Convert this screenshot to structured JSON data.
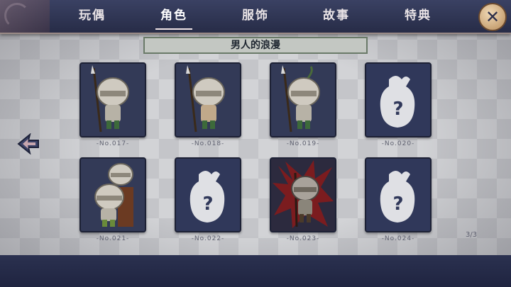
{
  "tabs": [
    {
      "label": "玩偶",
      "active": false
    },
    {
      "label": "角色",
      "active": true
    },
    {
      "label": "服饰",
      "active": false
    },
    {
      "label": "故事",
      "active": false
    },
    {
      "label": "特典",
      "active": false
    }
  ],
  "close_icon": "close-icon",
  "banner_title": "男人的浪漫",
  "cards": [
    {
      "id": "-No.017-",
      "state": "unlocked",
      "figure": "knight-with-spear"
    },
    {
      "id": "-No.018-",
      "state": "unlocked",
      "figure": "knight-with-spear"
    },
    {
      "id": "-No.019-",
      "state": "unlocked",
      "figure": "knight-with-spear-plume"
    },
    {
      "id": "-No.020-",
      "state": "locked",
      "figure": "mystery-silhouette"
    },
    {
      "id": "-No.021-",
      "state": "unlocked",
      "figure": "two-knights-on-chair"
    },
    {
      "id": "-No.022-",
      "state": "locked",
      "figure": "mystery-silhouette"
    },
    {
      "id": "-No.023-",
      "state": "unlocked",
      "figure": "knight-red-aura"
    },
    {
      "id": "-No.024-",
      "state": "locked",
      "figure": "mystery-silhouette"
    }
  ],
  "page_indicator": "3/3",
  "colors": {
    "topbar": "#2e3455",
    "card": "#333a57",
    "banner": "#c3c7c2",
    "aura": "#8a1a1a"
  }
}
